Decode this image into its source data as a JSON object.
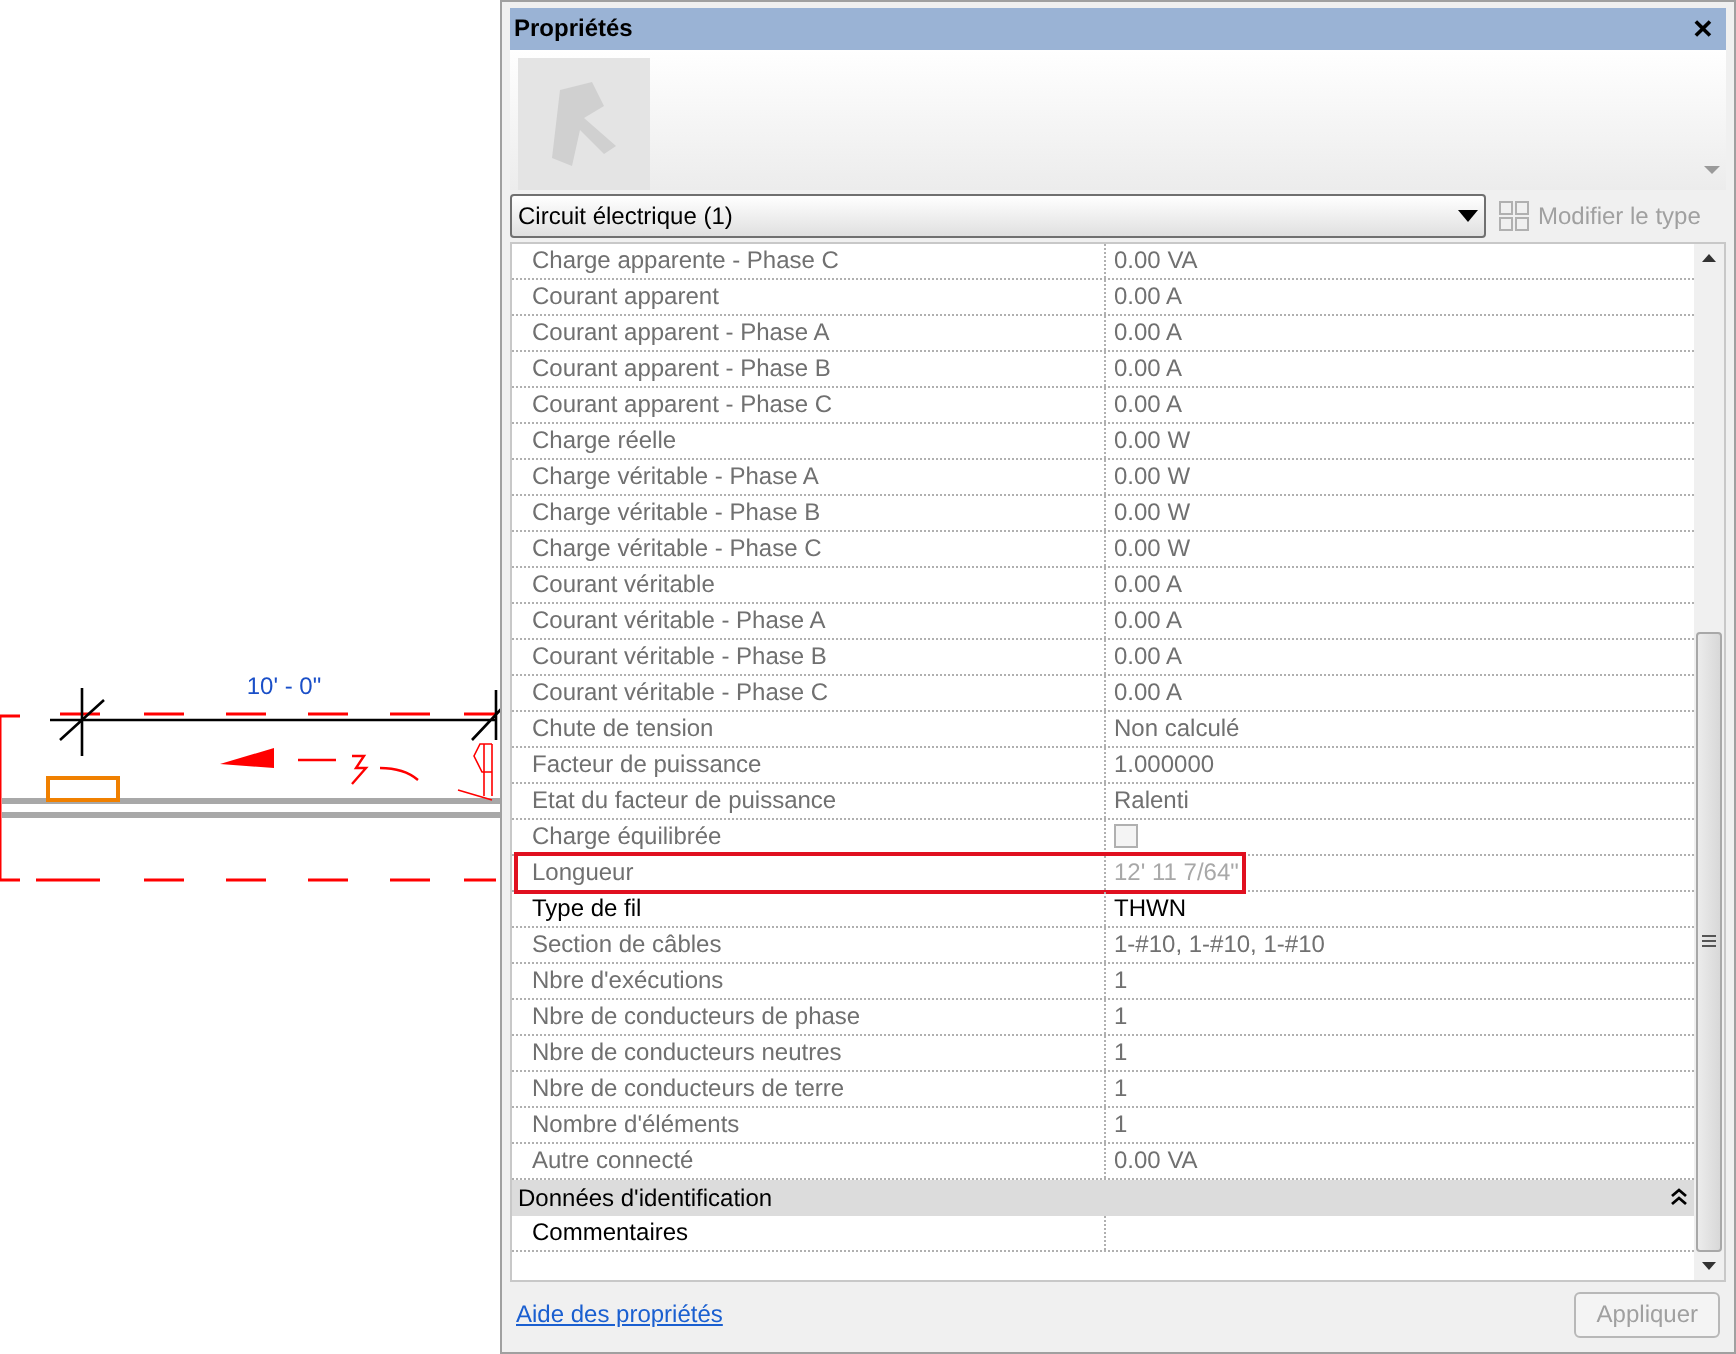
{
  "drawing": {
    "dimension": "10' - 0\""
  },
  "panel": {
    "title": "Propriétés",
    "close": "✕",
    "type_selector": "Circuit électrique (1)",
    "edit_type": "Modifier le type",
    "edit_type_disabled": true,
    "rows": [
      {
        "kind": "property",
        "name": "Charge apparente - Phase C",
        "value": "0.00 VA",
        "disabled": true
      },
      {
        "kind": "property",
        "name": "Courant apparent",
        "value": "0.00 A",
        "disabled": true
      },
      {
        "kind": "property",
        "name": "Courant apparent - Phase A",
        "value": "0.00 A",
        "disabled": true
      },
      {
        "kind": "property",
        "name": "Courant apparent - Phase B",
        "value": "0.00 A",
        "disabled": true
      },
      {
        "kind": "property",
        "name": "Courant apparent - Phase C",
        "value": "0.00 A",
        "disabled": true
      },
      {
        "kind": "property",
        "name": "Charge réelle",
        "value": "0.00 W",
        "disabled": true
      },
      {
        "kind": "property",
        "name": "Charge véritable - Phase A",
        "value": "0.00 W",
        "disabled": true
      },
      {
        "kind": "property",
        "name": "Charge véritable - Phase B",
        "value": "0.00 W",
        "disabled": true
      },
      {
        "kind": "property",
        "name": "Charge véritable - Phase C",
        "value": "0.00 W",
        "disabled": true
      },
      {
        "kind": "property",
        "name": "Courant véritable",
        "value": "0.00 A",
        "disabled": true
      },
      {
        "kind": "property",
        "name": "Courant véritable - Phase A",
        "value": "0.00 A",
        "disabled": true
      },
      {
        "kind": "property",
        "name": "Courant véritable - Phase B",
        "value": "0.00 A",
        "disabled": true
      },
      {
        "kind": "property",
        "name": "Courant véritable - Phase C",
        "value": "0.00 A",
        "disabled": true
      },
      {
        "kind": "property",
        "name": "Chute de tension",
        "value": "Non calculé",
        "disabled": true
      },
      {
        "kind": "property",
        "name": "Facteur de puissance",
        "value": "1.000000",
        "disabled": true
      },
      {
        "kind": "property",
        "name": "Etat du facteur de puissance",
        "value": "Ralenti",
        "disabled": true
      },
      {
        "kind": "checkbox",
        "name": "Charge équilibrée",
        "checked": false,
        "disabled": true
      },
      {
        "kind": "property",
        "name": "Longueur",
        "value": "12'  11 7/64\"",
        "disabled": true,
        "highlighted": true
      },
      {
        "kind": "property",
        "name": "Type de fil",
        "value": "THWN",
        "disabled": false
      },
      {
        "kind": "property",
        "name": "Section de câbles",
        "value": "1-#10, 1-#10, 1-#10",
        "disabled": true
      },
      {
        "kind": "property",
        "name": "Nbre d'exécutions",
        "value": "1",
        "disabled": true
      },
      {
        "kind": "property",
        "name": "Nbre de conducteurs de phase",
        "value": "1",
        "disabled": true
      },
      {
        "kind": "property",
        "name": "Nbre de conducteurs neutres",
        "value": "1",
        "disabled": true
      },
      {
        "kind": "property",
        "name": "Nbre de conducteurs de terre",
        "value": "1",
        "disabled": true
      },
      {
        "kind": "property",
        "name": "Nombre d'éléments",
        "value": "1",
        "disabled": true
      },
      {
        "kind": "property",
        "name": "Autre connecté",
        "value": "0.00 VA",
        "disabled": true
      },
      {
        "kind": "group",
        "name": "Données d'identification",
        "expanded": true
      },
      {
        "kind": "property",
        "name": "Commentaires",
        "value": "",
        "disabled": false
      }
    ],
    "help_link": "Aide des propriétés",
    "apply": "Appliquer",
    "apply_disabled": true
  }
}
